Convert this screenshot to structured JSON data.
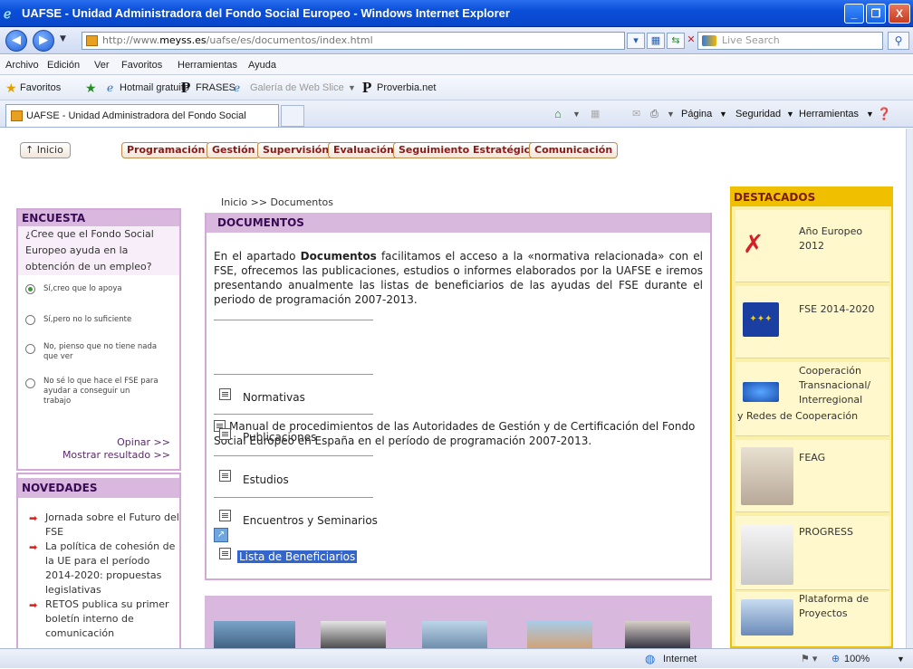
{
  "window": {
    "title": "UAFSE - Unidad Administradora del Fondo Social Europeo - Windows Internet Explorer",
    "minimize": "_",
    "restore": "❐",
    "close": "X"
  },
  "navbar": {
    "url_prefix": "http://www.",
    "url_domain": "meyss.es",
    "url_path": "/uafse/es/documentos/index.html",
    "search_placeholder": "Live Search"
  },
  "menu": [
    "Archivo",
    "Edición",
    "Ver",
    "Favoritos",
    "Herramientas",
    "Ayuda"
  ],
  "favorites": {
    "label": "Favoritos",
    "items": [
      "Hotmail gratuito",
      "FRASES",
      "Galería de Web Slice",
      "Proverbia.net"
    ],
    "p_glyph": "P"
  },
  "tab": {
    "title": "UAFSE - Unidad Administradora del Fondo Social Euro...",
    "pagina": "Página",
    "seguridad": "Seguridad",
    "herramientas": "Herramientas"
  },
  "topnav": {
    "inicio": "↑ Inicio",
    "items": [
      "Programación",
      "Gestión",
      "Supervisión",
      "Evaluación",
      "Seguimiento Estratégico",
      "Comunicación"
    ]
  },
  "encuesta": {
    "title": "ENCUESTA",
    "question": "¿Cree que el Fondo Social Europeo ayuda en la obtención de un empleo?",
    "options": [
      "Sí,creo que lo apoya",
      "Sí,pero no lo suficiente",
      "No, pienso que no tiene nada que ver",
      "No sé lo que hace el FSE para ayudar a conseguir un trabajo"
    ],
    "selected": 0,
    "opinar": "Opinar >>",
    "mostrar": "Mostrar resultado >>"
  },
  "novedades": {
    "title": "NOVEDADES",
    "items": [
      "Jornada sobre el Futuro del FSE",
      "La política de cohesión de la UE para el período 2014-2020: propuestas legislativas",
      "RETOS publica su primer boletín interno de comunicación"
    ]
  },
  "breadcrumb": "Inicio >> Documentos",
  "documentos": {
    "title": "DOCUMENTOS",
    "intro_before": "En el apartado ",
    "intro_bold": "Documentos",
    "intro_after": " facilitamos el acceso a la «normativa relacionada» con el FSE, ofrecemos las publicaciones, estudios o informes elaborados por la UAFSE e iremos  presentando anualmente las listas de beneficiarios de las ayudas del FSE durante el periodo de programación 2007-2013.",
    "manual": "Manual de procedimientos de las Autoridades de Gestión y de Certificación del Fondo Social Europeo en España en el período de programación 2007-2013.",
    "links": [
      "Normativas",
      "Publicaciones",
      "Estudios",
      "Encuentros y Seminarios",
      "Lista de Beneficiarios"
    ]
  },
  "destacados": {
    "title": "DESTACADOS",
    "items": [
      "Año Europeo 2012",
      "FSE 2014-2020",
      "Cooperación Transnacional/ Interregional",
      "FEAG",
      "PROGRESS",
      "Plataforma de Proyectos"
    ],
    "coop_extra": "y Redes de Cooperación"
  },
  "status": {
    "zone": "Internet",
    "zoom": "100%"
  },
  "colors": {
    "accent_purple": "#d9b8dd",
    "destacados_yellow": "#f0c000",
    "selection_blue": "#3366cc"
  }
}
